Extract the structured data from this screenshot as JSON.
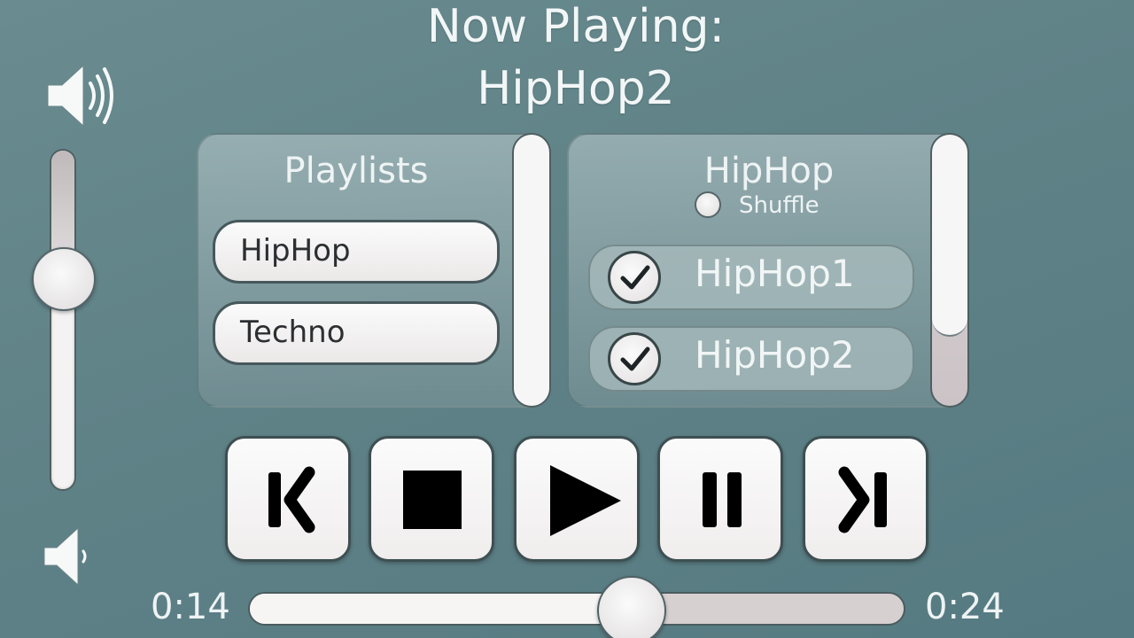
{
  "now_playing": {
    "label": "Now Playing:",
    "track": "HipHop2"
  },
  "volume": {
    "level": 0.62,
    "high_icon": "speaker-high-icon",
    "low_icon": "speaker-low-icon"
  },
  "playlists": {
    "heading": "Playlists",
    "items": [
      {
        "label": "HipHop"
      },
      {
        "label": "Techno"
      }
    ]
  },
  "songs": {
    "heading": "HipHop",
    "shuffle_label": "Shuffle",
    "shuffle_on": false,
    "items": [
      {
        "label": "HipHop1",
        "checked": true
      },
      {
        "label": "HipHop2",
        "checked": true
      }
    ]
  },
  "controls": [
    {
      "name": "previous",
      "icon": "skip-back-icon"
    },
    {
      "name": "stop",
      "icon": "stop-icon"
    },
    {
      "name": "play",
      "icon": "play-icon"
    },
    {
      "name": "pause",
      "icon": "pause-icon"
    },
    {
      "name": "next",
      "icon": "skip-forward-icon"
    }
  ],
  "progress": {
    "elapsed": "0:14",
    "total": "0:24",
    "fraction": 0.5833
  },
  "colors": {
    "background": "#5f8287",
    "panel": "#8ea6a9",
    "button_face": "#f6f4f4",
    "icon": "#000000"
  }
}
